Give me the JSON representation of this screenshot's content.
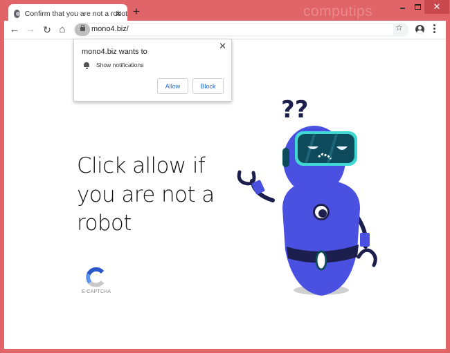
{
  "window": {
    "watermark": "computips",
    "controls": {
      "minimize": "minimize",
      "maximize": "maximize",
      "close": "✕"
    }
  },
  "tab": {
    "title": "Confirm that you are not a robot",
    "close": "✕",
    "new_tab": "+"
  },
  "toolbar": {
    "back": "←",
    "forward": "→",
    "reload": "↻",
    "home": "⌂",
    "url": "mono4.biz/",
    "bookmark": "☆"
  },
  "popup": {
    "title": "mono4.biz wants to",
    "permission": "Show notifications",
    "close": "✕",
    "allow_label": "Allow",
    "block_label": "Block"
  },
  "page": {
    "headline": "Click allow if you are not a robot",
    "captcha_label": "E-CAPTCHA"
  },
  "colors": {
    "frame": "#e06468",
    "robot_body": "#4a50e0",
    "robot_dark": "#1c1f4d",
    "visor": "#0d4a5c",
    "visor_rim": "#3fd8d2",
    "button_text": "#1a66d6"
  }
}
